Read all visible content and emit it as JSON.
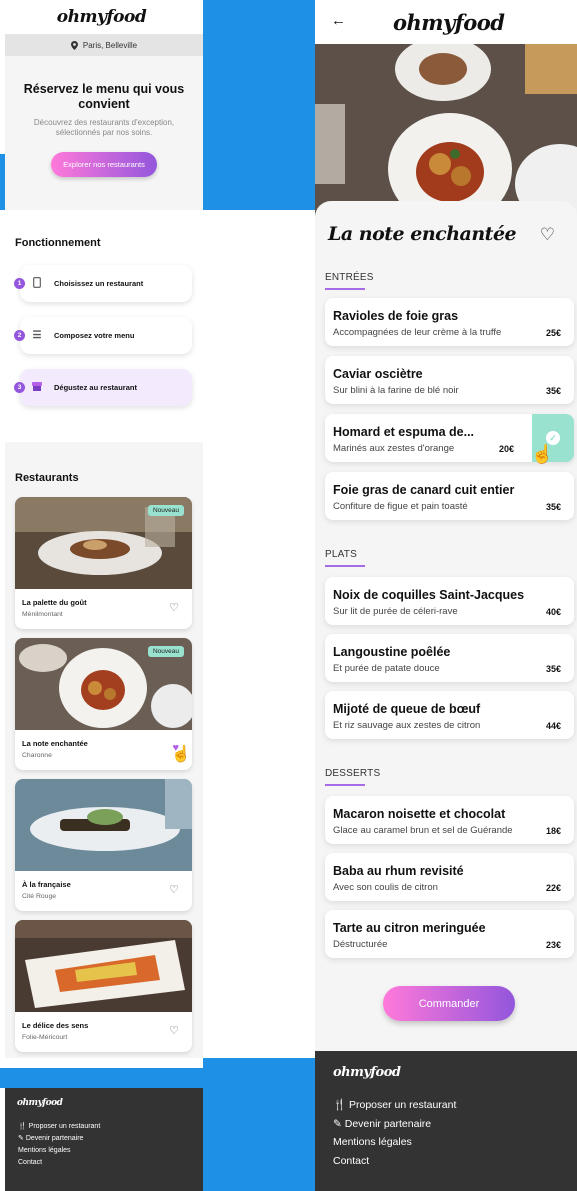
{
  "left": {
    "logo": "ohmyfood",
    "location": "Paris, Belleville",
    "hero": {
      "title": "Réservez le menu qui vous convient",
      "subtitle": "Découvrez des restaurants d'exception, sélectionnés par nos soins.",
      "cta": "Explorer nos restaurants"
    },
    "how_title": "Fonctionnement",
    "steps": [
      {
        "num": "1",
        "label": "Choisissez un restaurant",
        "icon": "phone-icon"
      },
      {
        "num": "2",
        "label": "Composez votre menu",
        "icon": "list-icon"
      },
      {
        "num": "3",
        "label": "Dégustez au restaurant",
        "icon": "restaurant-icon"
      }
    ],
    "restaurants_title": "Restaurants",
    "restaurants": [
      {
        "name": "La palette du goût",
        "area": "Ménilmontant",
        "badge": "Nouveau",
        "favorite": false
      },
      {
        "name": "La note enchantée",
        "area": "Charonne",
        "badge": "Nouveau",
        "favorite": true
      },
      {
        "name": "À la française",
        "area": "Cité Rouge",
        "badge": "",
        "favorite": false
      },
      {
        "name": "Le délice des sens",
        "area": "Folie-Méricourt",
        "badge": "",
        "favorite": false
      }
    ],
    "footer": {
      "logo": "ohmyfood",
      "links": [
        "Proposer un restaurant",
        "Devenir partenaire",
        "Mentions légales",
        "Contact"
      ]
    }
  },
  "right": {
    "logo": "ohmyfood",
    "title": "La note enchantée",
    "sections": {
      "starters": "ENTRÉES",
      "mains": "PLATS",
      "desserts": "DESSERTS"
    },
    "starters": [
      {
        "name": "Ravioles de foie gras",
        "desc": "Accompagnées de leur crème à la truffe",
        "price": "25€"
      },
      {
        "name": "Caviar osciètre",
        "desc": "Sur blini à la farine de blé noir",
        "price": "35€"
      },
      {
        "name": "Homard et espuma de...",
        "desc": "Marinés aux zestes d'orange",
        "price": "20€",
        "selected": true
      },
      {
        "name": "Foie gras de canard cuit entier",
        "desc": "Confiture de figue et pain toasté",
        "price": "35€"
      }
    ],
    "mains": [
      {
        "name": "Noix de coquilles Saint-Jacques",
        "desc": "Sur lit de purée de céleri-rave",
        "price": "40€"
      },
      {
        "name": "Langoustine poêlée",
        "desc": "Et purée de patate douce",
        "price": "35€"
      },
      {
        "name": "Mijoté de queue de bœuf",
        "desc": "Et riz sauvage aux zestes de citron",
        "price": "44€"
      }
    ],
    "desserts": [
      {
        "name": "Macaron noisette et chocolat",
        "desc": "Glace au caramel brun et sel de Guérande",
        "price": "18€"
      },
      {
        "name": "Baba au rhum revisité",
        "desc": "Avec son coulis de citron",
        "price": "22€"
      },
      {
        "name": "Tarte au citron meringuée",
        "desc": "Déstructurée",
        "price": "23€"
      }
    ],
    "order": "Commander",
    "footer": {
      "logo": "ohmyfood",
      "links": [
        "Proposer un restaurant",
        "Devenir partenaire",
        "Mentions légales",
        "Contact"
      ]
    }
  },
  "colors": {
    "accent_from": "#ff79da",
    "accent_to": "#9356dc",
    "mint": "#99e2d0",
    "background_blue": "#1e90e6",
    "footer": "#333333"
  }
}
